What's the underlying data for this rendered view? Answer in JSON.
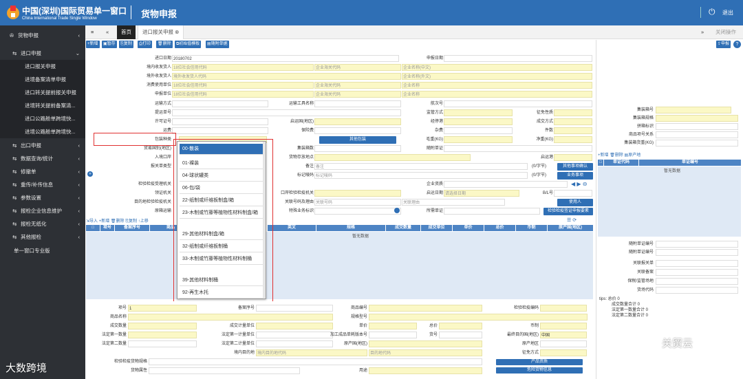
{
  "header": {
    "title": "中国(深圳)国际贸易单一窗口",
    "subtitle": "China International Trade Single Window",
    "module": "货物申报",
    "logout": "退出"
  },
  "sidebar": {
    "top": "货物申报",
    "group": "进口申报",
    "subs": [
      "进口报关申报",
      "进境备案清单申报",
      "进口转关提前报关申报",
      "进境转关提前备案清...",
      "进口公路舱单跨境快...",
      "进境公路舱单跨境快..."
    ],
    "items": [
      "出口申报",
      "数据查询/统计",
      "修撤单",
      "重传/补传信息",
      "参数设置",
      "报检企业信息维护",
      "报检无纸化",
      "其他报检",
      "单一窗口专业版"
    ]
  },
  "tabs": {
    "home": "首页",
    "current": "进口报关申报",
    "more": "关闭操作"
  },
  "toolbar": [
    "新增",
    "暂存",
    "复制",
    "打印",
    "删除",
    "初始值模板",
    "随附单据"
  ],
  "declare": "申报",
  "form": {
    "import_date_label": "进口日期",
    "import_date": "20180702",
    "declare_date_label": "申报日期",
    "consignee_label": "境内收发货人",
    "consignee_ph": "18位社会信用代码",
    "consignee_code_ph": "企业海关代码",
    "consignee_name_ph": "企业名称(中文)",
    "overseas_label": "境外收发货人",
    "overseas_ph": "境外收发货人代码",
    "overseas_name_ph": "企业名称(外文)",
    "consumer_label": "消费使用单位",
    "consumer_ph": "18位社会信用代码",
    "consumer_code_ph": "企业海关代码",
    "consumer_name_ph": "企业名称",
    "declarer_label": "申报单位",
    "declarer_ph": "18位社会信用代码",
    "declarer_code_ph": "企业海关代码",
    "declarer_name_ph": "企业名称",
    "transport_mode": "运输方式",
    "transport_tool": "运输工具名称",
    "voyage": "航次号",
    "bill_no": "提运单号",
    "supervise_mode": "监管方式",
    "tax_nature": "征免性质",
    "license_no": "许可证号",
    "origin_country": "启运国(地区)",
    "port": "经停港",
    "deal_mode": "成交方式",
    "freight": "运费",
    "insurance": "保险费",
    "misc": "杂费",
    "pieces": "件数",
    "pack_type": "包装种类",
    "other_pack": "其他包装",
    "gross_weight": "毛重(KG)",
    "net_weight": "净重(KG)",
    "trade_country": "贸易国别(地区)",
    "container_count": "集装箱数",
    "attached_docs": "随附单证",
    "entry_port": "入境口岸",
    "goods_location": "货物存放地点",
    "departure_port": "启运港",
    "customs_form": "报关单类型",
    "remarks": "备注",
    "remarks_ph": "备注",
    "mark_no": "标记唛码",
    "mark_no_ph": "标记唛码",
    "note_count": "(0/字节)",
    "other_confirm": "其他事项确认",
    "business_items": "业务事项",
    "inspection_authority": "检验检疫受理机关",
    "enterprise_qual": "企业资质",
    "entry_authority": "领证机关",
    "port_inspection": "口岸检验检疫机关",
    "arrival_date": "启运日期",
    "arrival_ph": "请选择日期",
    "bl_no": "B/L号",
    "dest_authority": "目的地检验检疫机关",
    "related_no": "关联号码及理由",
    "related_ph": "关联号码",
    "related_reason_ph": "关联理由",
    "user": "使用人",
    "original_item": "原箱运输",
    "special_business": "特殊业务标识",
    "required_cert": "所需单证",
    "inspection_cert": "检验检疫签证申报要素"
  },
  "grid": {
    "tools": [
      "导入",
      "新增",
      "删除",
      "复制",
      "上移"
    ],
    "cols": [
      "项号",
      "备案序号",
      "商品",
      "英文",
      "规格",
      "成交数量",
      "成交单位",
      "单价",
      "总价",
      "币制",
      "原产国(地区)"
    ],
    "empty": "暂无数据"
  },
  "dropdown": {
    "options": [
      "00-散装",
      "01-裸装",
      "04-球状罐类",
      "06-包/袋",
      "22-纸制或纤维板制盒/箱",
      "23-木制或竹藤等植物性材料制盒/箱",
      "29-其他材料制盒/箱",
      "32-纸制或纤维板制桶",
      "33-木制或竹藤等植物性材料制桶",
      "39-其他材料制桶",
      "92-再生木托"
    ]
  },
  "right": {
    "container_no": "集装箱号",
    "container_spec": "集装箱规格",
    "split_flag": "拼箱标识",
    "item_relation": "商品项号关系",
    "container_weight": "集装箱货重(KG)",
    "tool_new": "新增",
    "tool_del": "删除",
    "tool_origin": "原产地",
    "doc_code": "单证代码",
    "doc_no": "单证编号",
    "empty": "暂无数据",
    "att_no": "随附单证编号",
    "att_no2": "随附单证编号",
    "rel_declare": "关联报关单",
    "rel_record": "关联备案",
    "bond_place": "保税/监管场地",
    "yard_code": "货场代码",
    "tips_title": "tips: 总价 0",
    "tips": [
      "成交数量合计 0",
      "法定第一数量合计 0",
      "法定第二数量合计 0"
    ]
  },
  "bottom": {
    "item_no": "项号",
    "item_no_v": "1",
    "record_no": "备案序号",
    "goods_no": "商品编号",
    "ins_code": "检验检疫编码",
    "goods_name": "商品名称",
    "spec": "规格型号",
    "deal_qty": "成交数量",
    "deal_unit": "成交计量单位",
    "price": "单价",
    "total": "总价",
    "currency": "币制",
    "legal_qty1": "法定第一数量",
    "legal_unit1": "法定第一计量单位",
    "processed_no": "加工成品单耗版本号",
    "goods_no2": "货号",
    "dest_country": "最终目的国(地区)",
    "dest_country_v": "中国",
    "legal_qty2": "法定第二数量",
    "legal_unit2": "法定第二计量单位",
    "origin": "原产国(地区)",
    "origin2": "原产地区",
    "dest_place": "境内目的地",
    "dest_place_ph": "境内目的地代码",
    "dest_place_ph2": "目的地代码",
    "tax_mode": "征免方式",
    "ins_spec": "检验检疫货物规格",
    "goods_attr": "货物属性",
    "use": "用途",
    "prod_qual": "产品资质",
    "danger": "危险货物信息"
  },
  "watermark": {
    "left": "大数跨境",
    "right": "关贸云"
  }
}
